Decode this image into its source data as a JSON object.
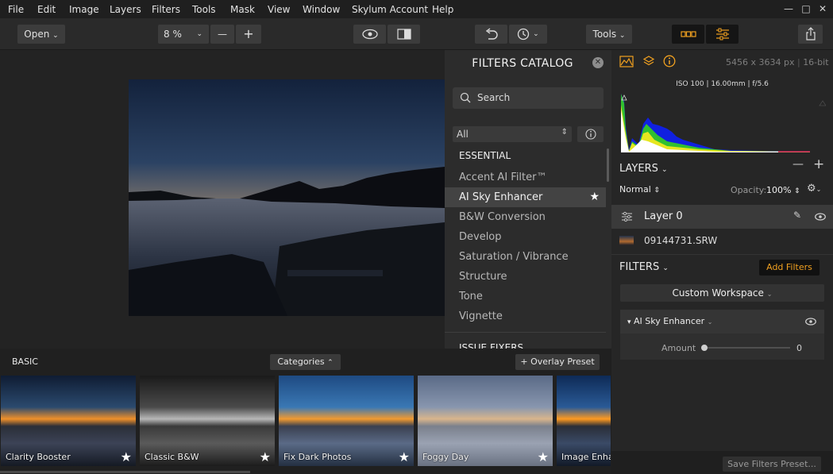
{
  "menu": [
    "File",
    "Edit",
    "Image",
    "Layers",
    "Filters",
    "Tools",
    "Mask",
    "View",
    "Window",
    "Skylum Account",
    "Help"
  ],
  "window_controls": {
    "minimize": "—",
    "maximize": "□",
    "close": "✕"
  },
  "toolbar": {
    "open_label": "Open",
    "zoom_value": "8 %",
    "zoom_out": "—",
    "zoom_in": "+",
    "tools_label": "Tools"
  },
  "catalog": {
    "title": "FILTERS CATALOG",
    "search_placeholder": "Search",
    "dropdown_value": "All",
    "section1": "ESSENTIAL",
    "items": [
      "Accent AI Filter™",
      "AI Sky Enhancer",
      "B&W Conversion",
      "Develop",
      "Saturation / Vibrance",
      "Structure",
      "Tone",
      "Vignette"
    ],
    "active_index": 1,
    "section2": "ISSUE FIXERS"
  },
  "info": {
    "dimensions": "5456 x 3634 px",
    "bit_depth": "16-bit",
    "exif": "ISO 100 | 16.00mm | f/5.6"
  },
  "layers": {
    "title": "LAYERS",
    "blend_mode": "Normal",
    "opacity_label": "Opacity:",
    "opacity_value": "100%",
    "layer_name": "Layer 0",
    "file_name": "09144731.SRW"
  },
  "filters_panel": {
    "title": "FILTERS",
    "add_button": "Add Filters",
    "workspace": "Custom Workspace",
    "filter_name": "AI Sky Enhancer",
    "amount_label": "Amount",
    "amount_value": "0",
    "amount_level": 0,
    "save_preset": "Save Filters Preset..."
  },
  "presets": {
    "category_label": "BASIC",
    "categories_button": "Categories",
    "overlay_button": "+ Overlay Preset",
    "items": [
      "Clarity Booster",
      "Classic B&W",
      "Fix Dark Photos",
      "Foggy Day",
      "Image Enhancer"
    ]
  },
  "colors": {
    "accent_orange": "#f0a020",
    "background": "#1e1e1e",
    "panel": "#262626"
  }
}
